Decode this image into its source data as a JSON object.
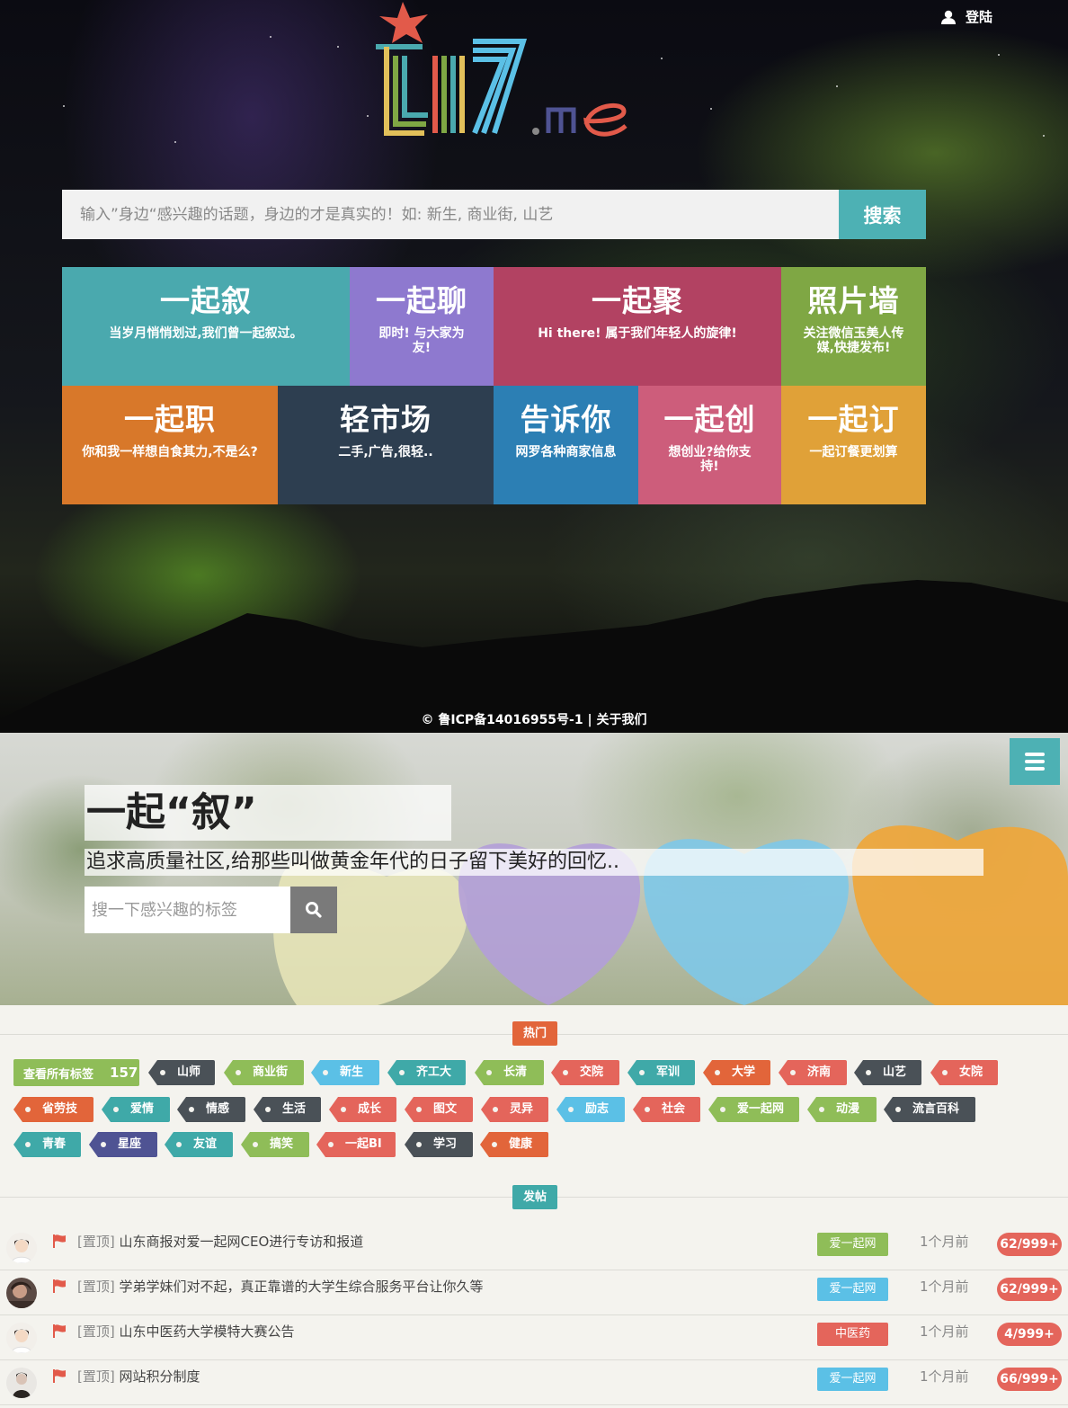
{
  "header": {
    "login_label": "登陆"
  },
  "logo": {
    "brand": "LI7",
    "suffix": ".me"
  },
  "hero_search": {
    "placeholder": "输入”身边“感兴趣的话题，身边的才是真实的！如: 新生, 商业街, 山艺",
    "button_label": "搜索"
  },
  "tiles": [
    {
      "title": "一起叙",
      "subtitle": "当岁月悄悄划过,我们曾一起叙过。",
      "color": "#4aa9ae"
    },
    {
      "title": "一起聊",
      "subtitle": "即时! 与大家为友!",
      "color": "#8e79cf"
    },
    {
      "title": "一起聚",
      "subtitle": "Hi there! 属于我们年轻人的旋律!",
      "color": "#b24262"
    },
    {
      "title": "照片墙",
      "subtitle": "关注微信玉美人传媒,快捷发布!",
      "color": "#7fa744"
    },
    {
      "title": "一起职",
      "subtitle": "你和我一样想自食其力,不是么?",
      "color": "#d8782a"
    },
    {
      "title": "轻市场",
      "subtitle": "二手,广告,很轻..",
      "color": "#2d3e50"
    },
    {
      "title": "告诉你",
      "subtitle": "网罗各种商家信息",
      "color": "#2c7fb4"
    },
    {
      "title": "一起创",
      "subtitle": "想创业?给你支持!",
      "color": "#cd5d7b"
    },
    {
      "title": "一起订",
      "subtitle": "一起订餐更划算",
      "color": "#e0a138"
    }
  ],
  "footer_hero": {
    "icp": "© 鲁ICP备14016955号-1",
    "separator": " | ",
    "about": "关于我们"
  },
  "banner": {
    "title": "一起“叙”",
    "subtitle": "追求高质量社区,给那些叫做黄金年代的日子留下美好的回忆..",
    "search_placeholder": "搜一下感兴趣的标签"
  },
  "hot_section": {
    "label": "热门",
    "all_tags_label": "查看所有标签",
    "all_tags_count": "157",
    "tags": [
      {
        "label": "山师",
        "color": "#4a5157"
      },
      {
        "label": "商业街",
        "color": "#8fbd58"
      },
      {
        "label": "新生",
        "color": "#5bc0e6"
      },
      {
        "label": "齐工大",
        "color": "#3fa9a8"
      },
      {
        "label": "长清",
        "color": "#8fbd58"
      },
      {
        "label": "交院",
        "color": "#e4655b"
      },
      {
        "label": "军训",
        "color": "#3fa9a8"
      },
      {
        "label": "大学",
        "color": "#e2653a"
      },
      {
        "label": "济南",
        "color": "#e4655b"
      },
      {
        "label": "山艺",
        "color": "#4a5157"
      },
      {
        "label": "女院",
        "color": "#e4655b"
      },
      {
        "label": "省劳技",
        "color": "#e2653a"
      },
      {
        "label": "爱情",
        "color": "#3fa9a8"
      },
      {
        "label": "情感",
        "color": "#4a5157"
      },
      {
        "label": "生活",
        "color": "#4a5157"
      },
      {
        "label": "成长",
        "color": "#e4655b"
      },
      {
        "label": "图文",
        "color": "#e4655b"
      },
      {
        "label": "灵异",
        "color": "#e4655b"
      },
      {
        "label": "励志",
        "color": "#5bc0e6"
      },
      {
        "label": "社会",
        "color": "#e4655b"
      },
      {
        "label": "爱一起网",
        "color": "#8fbd58"
      },
      {
        "label": "动漫",
        "color": "#8fbd58"
      },
      {
        "label": "流言百科",
        "color": "#4a5157"
      },
      {
        "label": "青春",
        "color": "#3fa9a8"
      },
      {
        "label": "星座",
        "color": "#4f5393"
      },
      {
        "label": "友谊",
        "color": "#3fa9a8"
      },
      {
        "label": "搞笑",
        "color": "#8fbd58"
      },
      {
        "label": "一起BI",
        "color": "#e4655b"
      },
      {
        "label": "学习",
        "color": "#4a5157"
      },
      {
        "label": "健康",
        "color": "#e2653a"
      }
    ]
  },
  "posts_section": {
    "label": "发帖",
    "posts": [
      {
        "pin": "[置顶]",
        "title": "山东商报对爱一起网CEO进行专访和报道",
        "category": "爱一起网",
        "category_color": "#8fbd58",
        "time": "1个月前",
        "count": "62/999+"
      },
      {
        "pin": "[置顶]",
        "title": "学弟学妹们对不起，真正靠谱的大学生综合服务平台让你久等",
        "category": "爱一起网",
        "category_color": "#5bc0e6",
        "time": "1个月前",
        "count": "62/999+"
      },
      {
        "pin": "[置顶]",
        "title": "山东中医药大学模特大赛公告",
        "category": "中医药",
        "category_color": "#e4655b",
        "time": "1个月前",
        "count": "4/999+"
      },
      {
        "pin": "[置顶]",
        "title": "网站积分制度",
        "category": "爱一起网",
        "category_color": "#5bc0e6",
        "time": "1个月前",
        "count": "66/999+"
      }
    ]
  }
}
